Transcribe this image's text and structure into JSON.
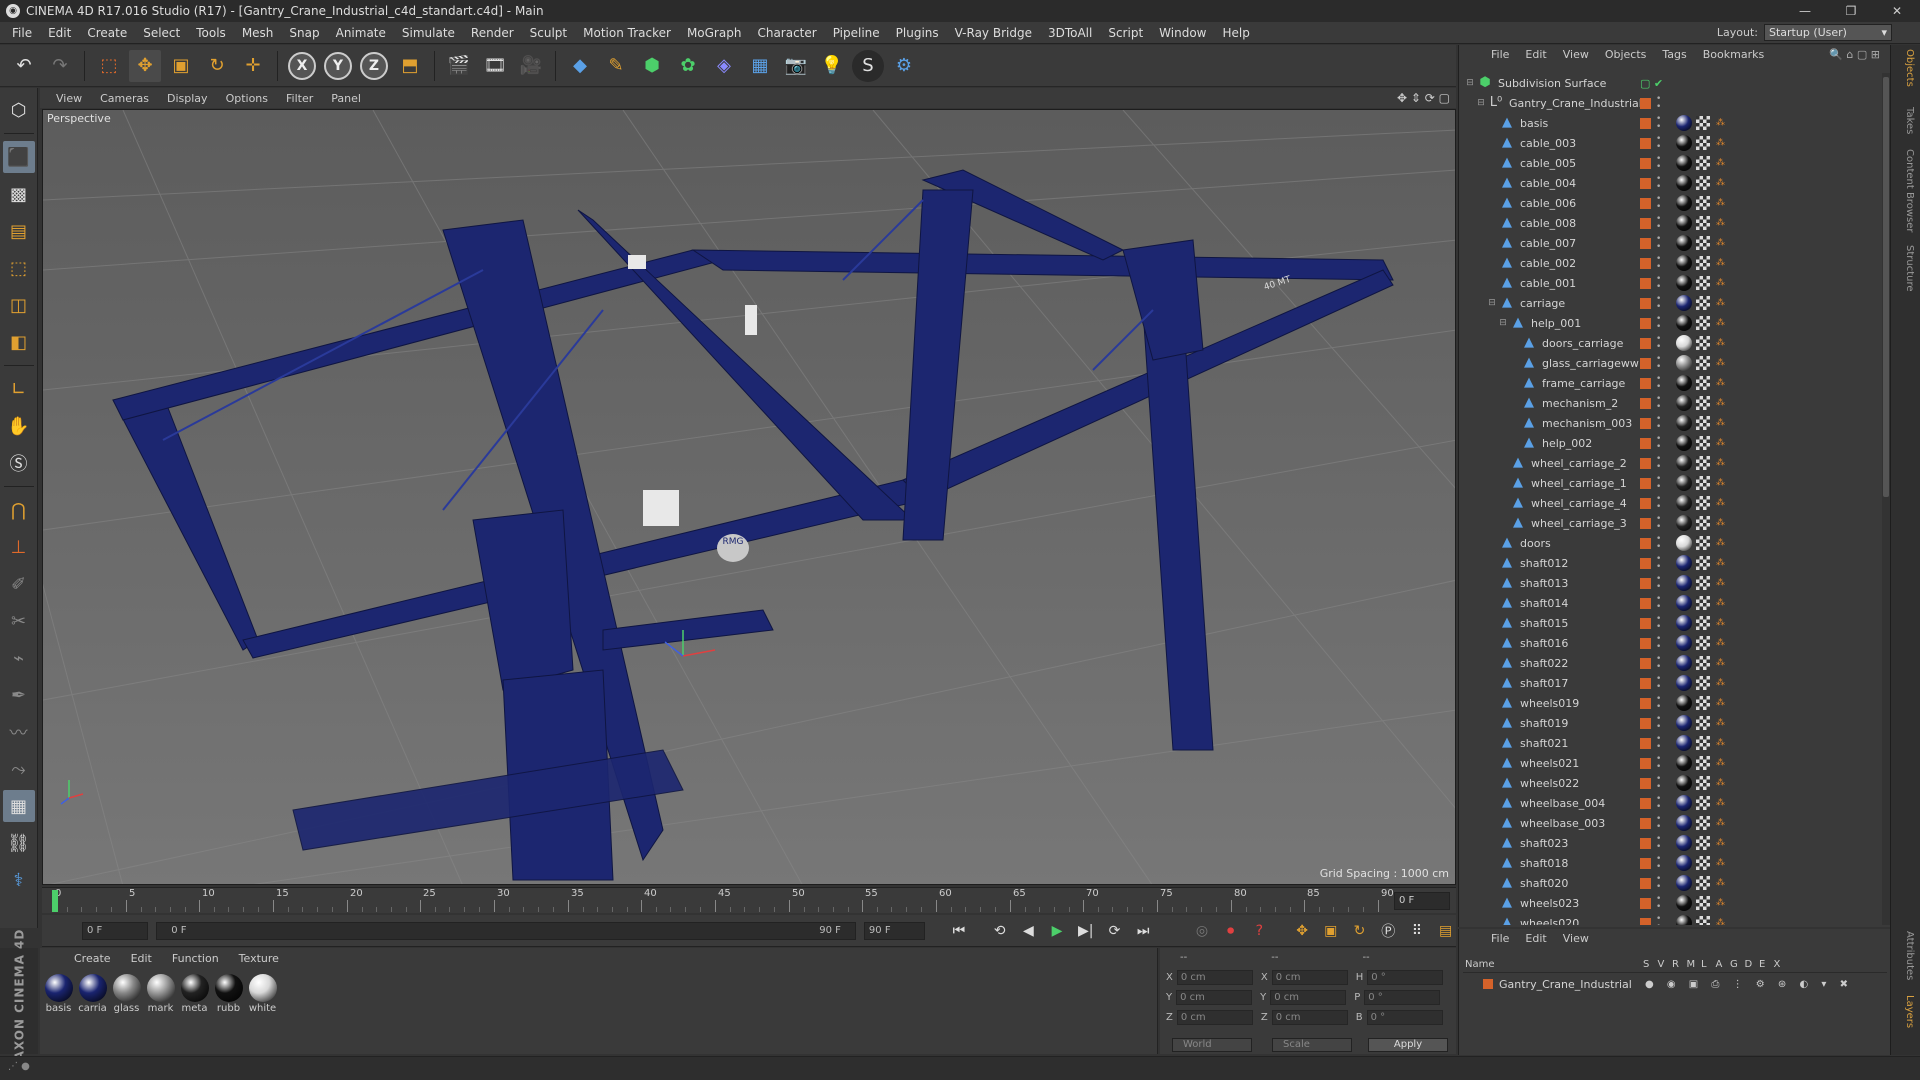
{
  "window": {
    "title": "CINEMA 4D R17.016 Studio (R17) - [Gantry_Crane_Industrial_c4d_standart.c4d] - Main",
    "controls": [
      "—",
      "❐",
      "✕"
    ]
  },
  "menu": [
    "File",
    "Edit",
    "Create",
    "Select",
    "Tools",
    "Mesh",
    "Snap",
    "Animate",
    "Simulate",
    "Render",
    "Sculpt",
    "Motion Tracker",
    "MoGraph",
    "Character",
    "Pipeline",
    "Plugins",
    "V-Ray Bridge",
    "3DToAll",
    "Script",
    "Window",
    "Help"
  ],
  "layout": {
    "label": "Layout:",
    "value": "Startup (User)"
  },
  "viewport": {
    "menu": [
      "View",
      "Cameras",
      "Display",
      "Options",
      "Filter",
      "Panel"
    ],
    "label": "Perspective",
    "grid_spacing": "Grid Spacing : 1000 cm",
    "crane_color": "#1c2670",
    "sign_text": "RMG\n1",
    "beam_text": "40 MT"
  },
  "timeline": {
    "ticks": [
      "0",
      "5",
      "10",
      "15",
      "20",
      "25",
      "30",
      "35",
      "40",
      "45",
      "50",
      "55",
      "60",
      "65",
      "70",
      "75",
      "80",
      "85",
      "90"
    ],
    "frame_end": "0 F"
  },
  "transport": {
    "start_field": "0 F",
    "range_field": "0 F",
    "range_end": "90 F",
    "end_field": "90 F"
  },
  "materials": {
    "menu": [
      "Create",
      "Edit",
      "Function",
      "Texture"
    ],
    "items": [
      {
        "label": "basis",
        "color": "#1a2470"
      },
      {
        "label": "carria",
        "color": "#1a2470"
      },
      {
        "label": "glass",
        "color": "#888888"
      },
      {
        "label": "mark",
        "color": "#9a9a9a"
      },
      {
        "label": "meta",
        "color": "#222222"
      },
      {
        "label": "rubb",
        "color": "#111111"
      },
      {
        "label": "white",
        "color": "#d8d8d8"
      }
    ]
  },
  "maxon": "MAXON CINEMA 4D",
  "coords": {
    "header": [
      "--",
      "--",
      "--"
    ],
    "rows": [
      {
        "a": "X",
        "av": "0 cm",
        "b": "X",
        "bv": "0 cm",
        "c": "H",
        "cv": "0 °"
      },
      {
        "a": "Y",
        "av": "0 cm",
        "b": "Y",
        "bv": "0 cm",
        "c": "P",
        "cv": "0 °"
      },
      {
        "a": "Z",
        "av": "0 cm",
        "b": "Z",
        "bv": "0 cm",
        "c": "B",
        "cv": "0 °"
      }
    ],
    "mode1": "World",
    "mode2": "Scale",
    "apply": "Apply"
  },
  "object_manager": {
    "menu": [
      "File",
      "Edit",
      "View",
      "Objects",
      "Tags",
      "Bookmarks"
    ],
    "objects": [
      {
        "name": "Subdivision Surface",
        "level": 0,
        "expand": "−",
        "type": "subdiv"
      },
      {
        "name": "Gantry_Crane_Industrial",
        "level": 1,
        "expand": "−",
        "type": "null"
      },
      {
        "name": "basis",
        "level": 2,
        "tag": "#1a2470"
      },
      {
        "name": "cable_003",
        "level": 2,
        "tag": "#111"
      },
      {
        "name": "cable_005",
        "level": 2,
        "tag": "#111"
      },
      {
        "name": "cable_004",
        "level": 2,
        "tag": "#111"
      },
      {
        "name": "cable_006",
        "level": 2,
        "tag": "#111"
      },
      {
        "name": "cable_008",
        "level": 2,
        "tag": "#111"
      },
      {
        "name": "cable_007",
        "level": 2,
        "tag": "#111"
      },
      {
        "name": "cable_002",
        "level": 2,
        "tag": "#111"
      },
      {
        "name": "cable_001",
        "level": 2,
        "tag": "#111"
      },
      {
        "name": "carriage",
        "level": 2,
        "expand": "−",
        "tag": "#1a2470"
      },
      {
        "name": "help_001",
        "level": 3,
        "expand": "−",
        "tag": "#111"
      },
      {
        "name": "doors_carriage",
        "level": 4,
        "tag": "#d8d8d8"
      },
      {
        "name": "glass_carriageww",
        "level": 4,
        "tag": "#888"
      },
      {
        "name": "frame_carriage",
        "level": 4,
        "tag": "#111"
      },
      {
        "name": "mechanism_2",
        "level": 4,
        "tag": "#222"
      },
      {
        "name": "mechanism_003",
        "level": 4,
        "tag": "#222"
      },
      {
        "name": "help_002",
        "level": 4,
        "tag": "#111"
      },
      {
        "name": "wheel_carriage_2",
        "level": 3,
        "tag": "#222"
      },
      {
        "name": "wheel_carriage_1",
        "level": 3,
        "tag": "#222"
      },
      {
        "name": "wheel_carriage_4",
        "level": 3,
        "tag": "#222"
      },
      {
        "name": "wheel_carriage_3",
        "level": 3,
        "tag": "#222"
      },
      {
        "name": "doors",
        "level": 2,
        "tag": "#d8d8d8"
      },
      {
        "name": "shaft012",
        "level": 2,
        "tag": "#1a2470"
      },
      {
        "name": "shaft013",
        "level": 2,
        "tag": "#1a2470"
      },
      {
        "name": "shaft014",
        "level": 2,
        "tag": "#1a2470"
      },
      {
        "name": "shaft015",
        "level": 2,
        "tag": "#1a2470"
      },
      {
        "name": "shaft016",
        "level": 2,
        "tag": "#1a2470"
      },
      {
        "name": "shaft022",
        "level": 2,
        "tag": "#1a2470"
      },
      {
        "name": "shaft017",
        "level": 2,
        "tag": "#1a2470"
      },
      {
        "name": "wheels019",
        "level": 2,
        "tag": "#111"
      },
      {
        "name": "shaft019",
        "level": 2,
        "tag": "#1a2470"
      },
      {
        "name": "shaft021",
        "level": 2,
        "tag": "#1a2470"
      },
      {
        "name": "wheels021",
        "level": 2,
        "tag": "#111"
      },
      {
        "name": "wheels022",
        "level": 2,
        "tag": "#111"
      },
      {
        "name": "wheelbase_004",
        "level": 2,
        "tag": "#1a2470"
      },
      {
        "name": "wheelbase_003",
        "level": 2,
        "tag": "#1a2470"
      },
      {
        "name": "shaft023",
        "level": 2,
        "tag": "#1a2470"
      },
      {
        "name": "shaft018",
        "level": 2,
        "tag": "#1a2470"
      },
      {
        "name": "shaft020",
        "level": 2,
        "tag": "#1a2470"
      },
      {
        "name": "wheels023",
        "level": 2,
        "tag": "#111"
      },
      {
        "name": "wheels020",
        "level": 2,
        "tag": "#111"
      }
    ]
  },
  "layer_manager": {
    "menu": [
      "File",
      "Edit",
      "View"
    ],
    "columns": [
      "Name",
      "S",
      "V",
      "R",
      "M",
      "L",
      "A",
      "G",
      "D",
      "E",
      "X"
    ],
    "row": "Gantry_Crane_Industrial"
  },
  "side_tabs": [
    "Objects",
    "Takes",
    "Content Browser",
    "Structure"
  ],
  "side_tabs_bottom": [
    "Attributes",
    "Layers"
  ]
}
